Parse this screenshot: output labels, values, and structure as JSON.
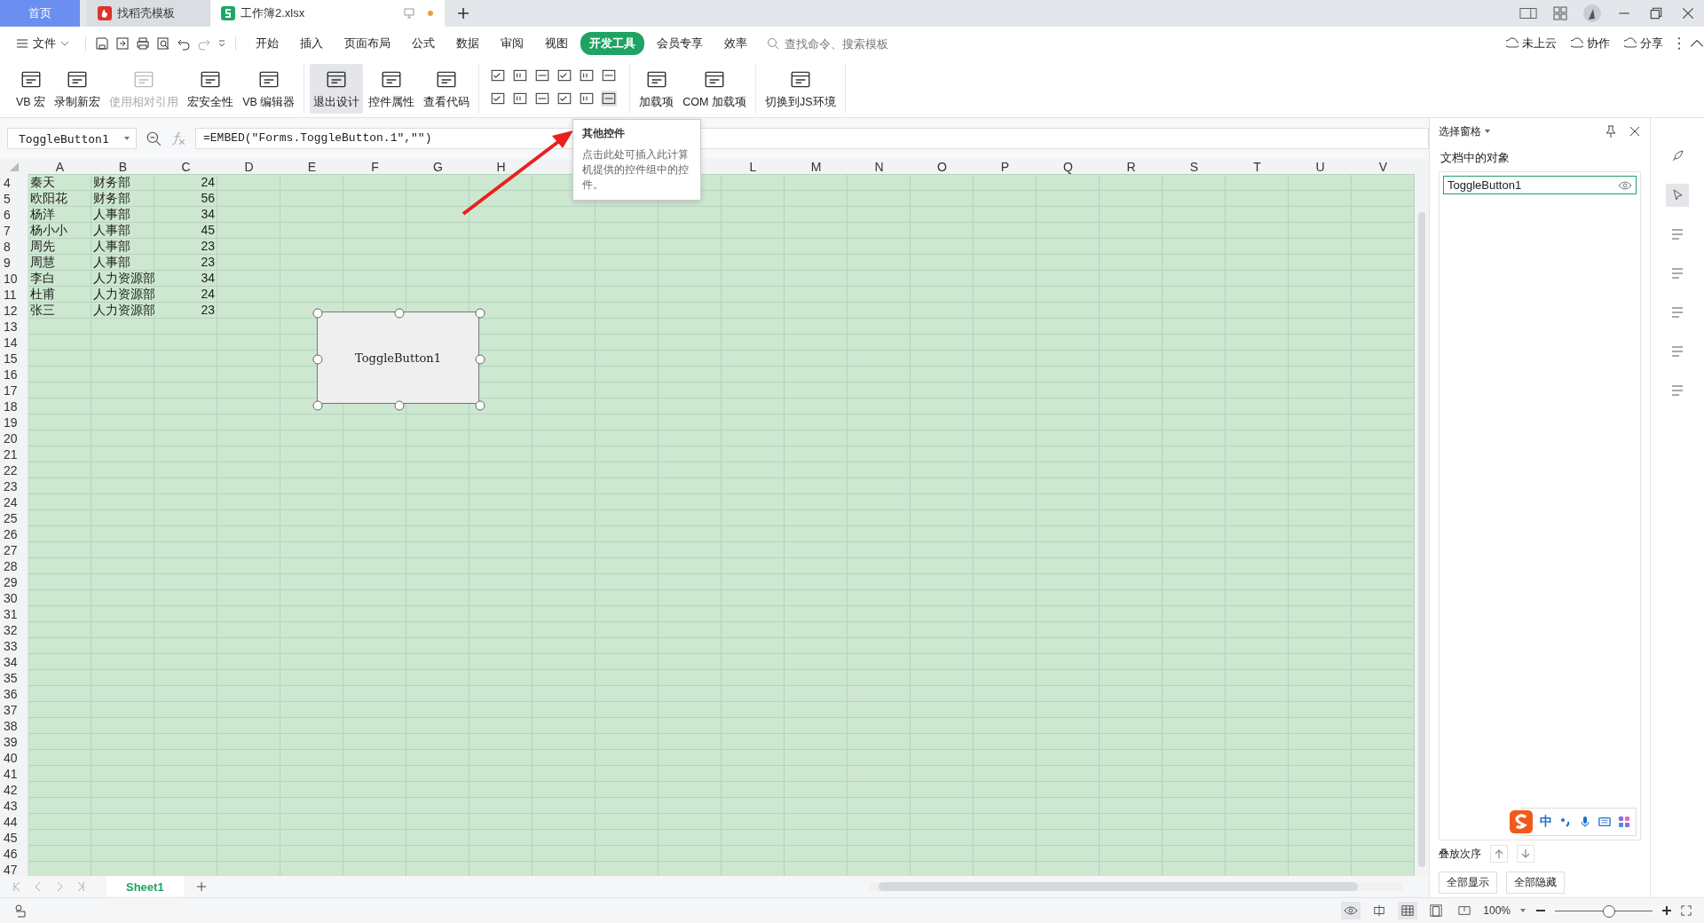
{
  "tabs": [
    {
      "label": "首页",
      "selected": false,
      "kind": "home"
    },
    {
      "label": "找稻壳模板",
      "selected": false,
      "kind": "doc"
    },
    {
      "label": "工作簿2.xlsx",
      "selected": true,
      "kind": "sheet"
    }
  ],
  "menu": {
    "file": "文件",
    "items": [
      {
        "label": "开始",
        "selected": false
      },
      {
        "label": "插入",
        "selected": false
      },
      {
        "label": "页面布局",
        "selected": false
      },
      {
        "label": "公式",
        "selected": false
      },
      {
        "label": "数据",
        "selected": false
      },
      {
        "label": "审阅",
        "selected": false
      },
      {
        "label": "视图",
        "selected": false
      },
      {
        "label": "开发工具",
        "selected": true
      },
      {
        "label": "会员专享",
        "selected": false
      },
      {
        "label": "效率",
        "selected": false
      }
    ],
    "search": {
      "placeholder": "查找命令、搜索模板"
    },
    "actions": [
      "未上云",
      "协作",
      "分享"
    ]
  },
  "ribbon": [
    {
      "kind": "buttons",
      "items": [
        {
          "label": "VB 宏",
          "disabled": false,
          "pressed": false
        },
        {
          "label": "录制新宏",
          "disabled": false,
          "pressed": false
        },
        {
          "label": "使用相对引用",
          "disabled": true,
          "pressed": false
        },
        {
          "label": "宏安全性",
          "disabled": false,
          "pressed": false
        },
        {
          "label": "VB 编辑器",
          "disabled": false,
          "pressed": false
        }
      ]
    },
    {
      "kind": "buttons",
      "items": [
        {
          "label": "退出设计",
          "disabled": false,
          "pressed": true
        },
        {
          "label": "控件属性",
          "disabled": false,
          "pressed": false
        },
        {
          "label": "查看代码",
          "disabled": false,
          "pressed": false
        }
      ]
    },
    {
      "kind": "controls"
    },
    {
      "kind": "buttons",
      "items": [
        {
          "label": "加载项",
          "disabled": false,
          "pressed": false
        },
        {
          "label": "COM 加载项",
          "disabled": false,
          "pressed": false
        }
      ]
    },
    {
      "kind": "buttons",
      "items": [
        {
          "label": "切换到JS环境",
          "disabled": false,
          "pressed": false
        }
      ]
    }
  ],
  "name_box": "ToggleButton1",
  "formula": "=EMBED(\"Forms.ToggleButton.1\",\"\")",
  "tooltip": {
    "title": "其他控件",
    "text": "点击此处可插入此计算机提供的控件组中的控件。"
  },
  "columns": [
    {
      "label": "A"
    },
    {
      "label": "B"
    },
    {
      "label": "C"
    },
    {
      "label": "D"
    },
    {
      "label": "E"
    },
    {
      "label": "F"
    },
    {
      "label": "G"
    },
    {
      "label": "H"
    },
    {},
    {},
    {},
    {
      "label": "L"
    },
    {
      "label": "M"
    },
    {
      "label": "N"
    },
    {
      "label": "O"
    },
    {
      "label": "P"
    },
    {
      "label": "Q"
    },
    {
      "label": "R"
    },
    {
      "label": "S"
    },
    {
      "label": "T"
    },
    {
      "label": "U"
    },
    {
      "label": "V"
    }
  ],
  "rows": [
    {
      "number": "4",
      "cells": [
        "秦天",
        "财务部",
        "24"
      ]
    },
    {
      "number": "5",
      "cells": [
        "欧阳花",
        "财务部",
        "56"
      ]
    },
    {
      "number": "6",
      "cells": [
        "杨洋",
        "人事部",
        "34"
      ]
    },
    {
      "number": "7",
      "cells": [
        "杨小小",
        "人事部",
        "45"
      ]
    },
    {
      "number": "8",
      "cells": [
        "周先",
        "人事部",
        "23"
      ]
    },
    {
      "number": "9",
      "cells": [
        "周慧",
        "人事部",
        "23"
      ]
    },
    {
      "number": "10",
      "cells": [
        "李白",
        "人力资源部",
        "34"
      ]
    },
    {
      "number": "11",
      "cells": [
        "杜甫",
        "人力资源部",
        "24"
      ]
    },
    {
      "number": "12",
      "cells": [
        "张三",
        "人力资源部",
        "23"
      ]
    },
    {
      "number": "13"
    },
    {
      "number": "14"
    },
    {
      "number": "15"
    },
    {
      "number": "16"
    },
    {
      "number": "17"
    },
    {
      "number": "18"
    },
    {
      "number": "19"
    },
    {
      "number": "20"
    },
    {
      "number": "21"
    },
    {
      "number": "22"
    },
    {
      "number": "23"
    },
    {
      "number": "24"
    },
    {
      "number": "25"
    },
    {
      "number": "26"
    },
    {
      "number": "27"
    },
    {
      "number": "28"
    },
    {
      "number": "29"
    },
    {
      "number": "30"
    },
    {
      "number": "31"
    },
    {
      "number": "32"
    },
    {
      "number": "33"
    },
    {
      "number": "34"
    },
    {
      "number": "35"
    },
    {
      "number": "36"
    },
    {
      "number": "37"
    },
    {
      "number": "38"
    },
    {
      "number": "39"
    },
    {
      "number": "40"
    },
    {
      "number": "41"
    },
    {
      "number": "42"
    },
    {
      "number": "43"
    },
    {
      "number": "44"
    },
    {
      "number": "45"
    },
    {
      "number": "46"
    },
    {
      "number": "47"
    }
  ],
  "sheet_object": {
    "label": "ToggleButton1"
  },
  "selection_pane": {
    "title": "选择窗格",
    "heading": "文档中的对象",
    "objects": [
      {
        "name": "ToggleButton1",
        "visible": true
      }
    ],
    "order_label": "叠放次序",
    "buttons": [
      "全部显示",
      "全部隐藏"
    ]
  },
  "ime": {
    "mode": "中"
  },
  "sheets": [
    {
      "label": "Sheet1",
      "selected": true
    }
  ],
  "status": {
    "zoom": "100%",
    "level": 0.55
  }
}
